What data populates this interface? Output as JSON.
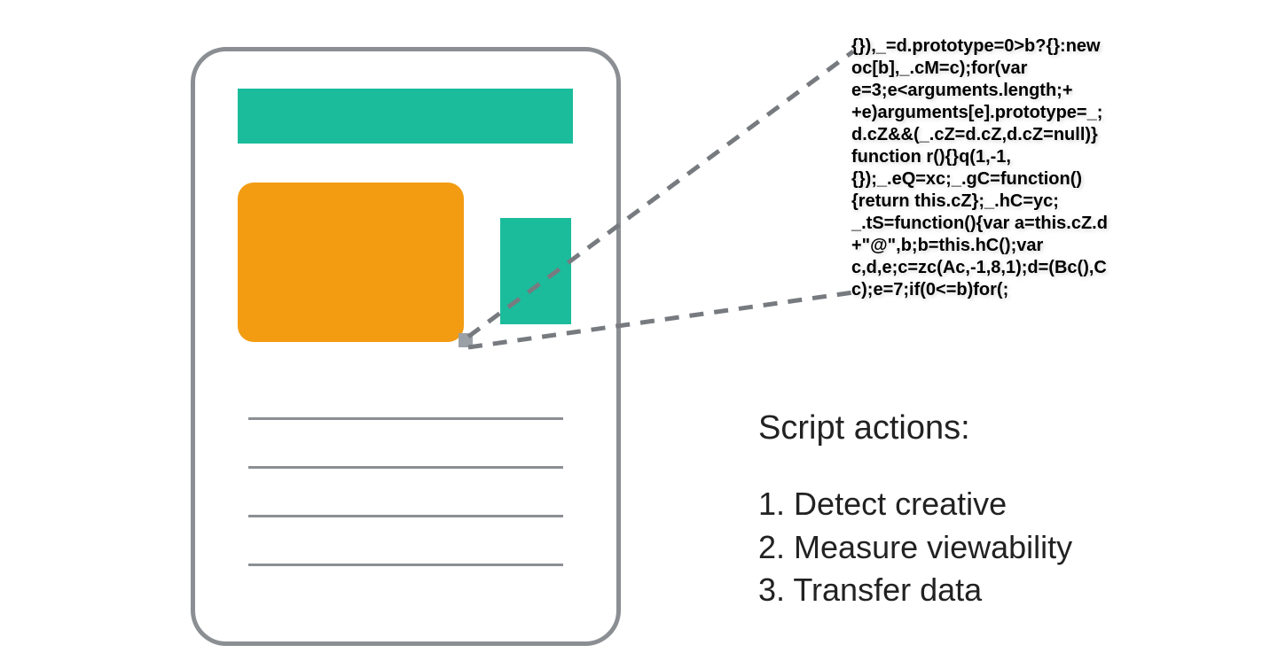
{
  "colors": {
    "teal": "#1abc9c",
    "orange": "#f39c12",
    "frame": "#8b8f93",
    "dash": "#777b80"
  },
  "phone": {
    "header_bar": "teal-banner",
    "ad_block": "orange-creative",
    "side_block": "teal-side",
    "text_lines": 4
  },
  "code": {
    "l1": "{}),_=d.prototype=0>b?{}:new",
    "l2": "oc[b],_.cM=c);for(var",
    "l3": "e=3;e<arguments.length;+",
    "l4": "+e)arguments[e].prototype=_;",
    "l5": "d.cZ&&(_.cZ=d.cZ,d.cZ=null)}",
    "l6": "function r(){}q(1,-1,",
    "l7": "{});_.eQ=xc;_.gC=function()",
    "l8": "{return this.cZ};_.hC=yc;",
    "l9": "_.tS=function(){var a=this.cZ.d",
    "l10": "+\"@\",b;b=this.hC();var",
    "l11": "c,d,e;c=zc(Ac,-1,8,1);d=(Bc(),C",
    "l12": "c);e=7;if(0<=b)for(;"
  },
  "script_actions": {
    "heading": "Script actions:",
    "items": [
      {
        "num": "1.",
        "label": "Detect creative"
      },
      {
        "num": "2.",
        "label": "Measure viewability"
      },
      {
        "num": "3.",
        "label": "Transfer data"
      }
    ]
  }
}
